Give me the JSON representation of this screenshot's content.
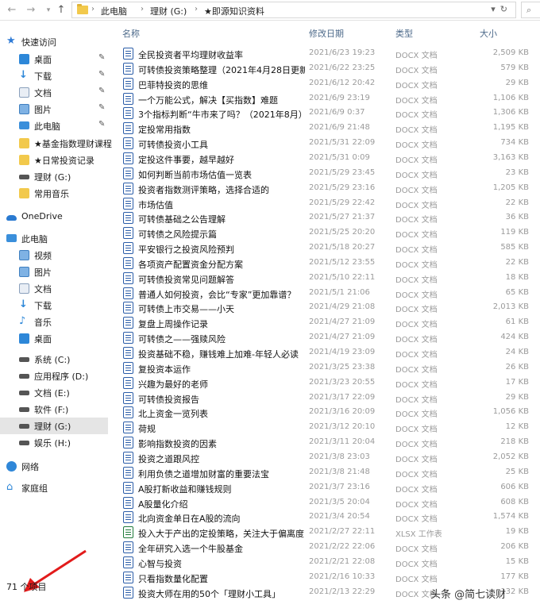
{
  "address_bar": {
    "segments": [
      "此电脑",
      "理财 (G:)",
      "★即源知识资料"
    ]
  },
  "sidebar": {
    "items": [
      {
        "label": "快速访问",
        "icon": "star-icon",
        "selected": false,
        "pinned": false
      },
      {
        "label": "桌面",
        "icon": "desktop-icon",
        "selected": false,
        "pinned": true
      },
      {
        "label": "下载",
        "icon": "download-icon",
        "selected": false,
        "pinned": true
      },
      {
        "label": "文档",
        "icon": "documents-icon",
        "selected": false,
        "pinned": true
      },
      {
        "label": "图片",
        "icon": "pictures-icon",
        "selected": false,
        "pinned": true
      },
      {
        "label": "此电脑",
        "icon": "computer-icon",
        "selected": false,
        "pinned": true
      },
      {
        "label": "★基金指数理财课程",
        "icon": "folder-icon",
        "selected": false,
        "pinned": false
      },
      {
        "label": "★日常投资记录",
        "icon": "folder-icon",
        "selected": false,
        "pinned": false
      },
      {
        "label": "理财 (G:)",
        "icon": "drive-icon",
        "selected": false,
        "pinned": false
      },
      {
        "label": "常用音乐",
        "icon": "folder-icon",
        "selected": false,
        "pinned": false
      },
      {
        "label": "OneDrive",
        "icon": "onedrive-icon",
        "selected": false,
        "pinned": false
      },
      {
        "label": "此电脑",
        "icon": "computer-icon",
        "selected": false,
        "pinned": false
      },
      {
        "label": "视频",
        "icon": "videos-icon",
        "selected": false,
        "pinned": false
      },
      {
        "label": "图片",
        "icon": "pictures-icon",
        "selected": false,
        "pinned": false
      },
      {
        "label": "文档",
        "icon": "documents-icon",
        "selected": false,
        "pinned": false
      },
      {
        "label": "下载",
        "icon": "download-icon",
        "selected": false,
        "pinned": false
      },
      {
        "label": "音乐",
        "icon": "music-icon",
        "selected": false,
        "pinned": false
      },
      {
        "label": "桌面",
        "icon": "desktop-icon",
        "selected": false,
        "pinned": false
      },
      {
        "label": "系统 (C:)",
        "icon": "drive-icon",
        "selected": false,
        "pinned": false
      },
      {
        "label": "应用程序 (D:)",
        "icon": "drive-icon",
        "selected": false,
        "pinned": false
      },
      {
        "label": "文档 (E:)",
        "icon": "drive-icon",
        "selected": false,
        "pinned": false
      },
      {
        "label": "软件 (F:)",
        "icon": "drive-icon",
        "selected": false,
        "pinned": false
      },
      {
        "label": "理财 (G:)",
        "icon": "drive-icon",
        "selected": true,
        "pinned": false
      },
      {
        "label": "娱乐 (H:)",
        "icon": "drive-icon",
        "selected": false,
        "pinned": false
      },
      {
        "label": "网络",
        "icon": "network-icon",
        "selected": false,
        "pinned": false
      },
      {
        "label": "家庭组",
        "icon": "homegroup-icon",
        "selected": false,
        "pinned": false
      }
    ]
  },
  "columns": {
    "name": "名称",
    "date": "修改日期",
    "type": "类型",
    "size": "大小"
  },
  "files": [
    {
      "name": "全民投资者平均理财收益率",
      "date": "2021/6/23 19:23",
      "type": "DOCX 文档",
      "size": "2,509 KB",
      "kind": "docx"
    },
    {
      "name": "可转债投资策略整理（2021年4月28日更新）",
      "date": "2021/6/22 23:25",
      "type": "DOCX 文档",
      "size": "579 KB",
      "kind": "docx"
    },
    {
      "name": "巴菲特投资的思维",
      "date": "2021/6/12 20:42",
      "type": "DOCX 文档",
      "size": "29 KB",
      "kind": "docx"
    },
    {
      "name": "一个万能公式，解决【买指数】难题",
      "date": "2021/6/9 23:19",
      "type": "DOCX 文档",
      "size": "1,106 KB",
      "kind": "docx"
    },
    {
      "name": "3个指标判断“牛市来了吗？（2021年8月）",
      "date": "2021/6/9 0:37",
      "type": "DOCX 文档",
      "size": "1,306 KB",
      "kind": "docx"
    },
    {
      "name": "定投常用指数",
      "date": "2021/6/9 21:48",
      "type": "DOCX 文档",
      "size": "1,195 KB",
      "kind": "docx"
    },
    {
      "name": "可转债投资小工具",
      "date": "2021/5/31 22:09",
      "type": "DOCX 文档",
      "size": "734 KB",
      "kind": "docx"
    },
    {
      "name": "定投这件事要，越早越好",
      "date": "2021/5/31 0:09",
      "type": "DOCX 文档",
      "size": "3,163 KB",
      "kind": "docx"
    },
    {
      "name": "如何判断当前市场估值一览表",
      "date": "2021/5/29 23:45",
      "type": "DOCX 文档",
      "size": "23 KB",
      "kind": "docx"
    },
    {
      "name": "投资者指数测评策略，选择合适的",
      "date": "2021/5/29 23:16",
      "type": "DOCX 文档",
      "size": "1,205 KB",
      "kind": "docx"
    },
    {
      "name": "市场估值",
      "date": "2021/5/29 22:42",
      "type": "DOCX 文档",
      "size": "22 KB",
      "kind": "docx"
    },
    {
      "name": "可转债基础之公告理解",
      "date": "2021/5/27 21:37",
      "type": "DOCX 文档",
      "size": "36 KB",
      "kind": "docx"
    },
    {
      "name": "可转债之风险提示篇",
      "date": "2021/5/25 20:20",
      "type": "DOCX 文档",
      "size": "119 KB",
      "kind": "docx"
    },
    {
      "name": "平安银行之投资风险预判",
      "date": "2021/5/18 20:27",
      "type": "DOCX 文档",
      "size": "585 KB",
      "kind": "docx"
    },
    {
      "name": "各项资产配置资金分配方案",
      "date": "2021/5/12 23:55",
      "type": "DOCX 文档",
      "size": "22 KB",
      "kind": "docx"
    },
    {
      "name": "可转债投资常见问题解答",
      "date": "2021/5/10 22:11",
      "type": "DOCX 文档",
      "size": "18 KB",
      "kind": "docx"
    },
    {
      "name": "普通人如何投资，会比“专家”更加靠谱？",
      "date": "2021/5/1 21:06",
      "type": "DOCX 文档",
      "size": "65 KB",
      "kind": "docx"
    },
    {
      "name": "可转债上市交易——小天",
      "date": "2021/4/29 21:08",
      "type": "DOCX 文档",
      "size": "2,013 KB",
      "kind": "docx"
    },
    {
      "name": "复盘上周操作记录",
      "date": "2021/4/27 21:09",
      "type": "DOCX 文档",
      "size": "61 KB",
      "kind": "docx"
    },
    {
      "name": "可转债之——强赎风险",
      "date": "2021/4/27 21:09",
      "type": "DOCX 文档",
      "size": "424 KB",
      "kind": "docx"
    },
    {
      "name": "投资基础不稳，赚钱难上加难-年轻人必读",
      "date": "2021/4/19 23:09",
      "type": "DOCX 文档",
      "size": "24 KB",
      "kind": "docx"
    },
    {
      "name": "复投资本运作",
      "date": "2021/3/25 23:38",
      "type": "DOCX 文档",
      "size": "26 KB",
      "kind": "docx"
    },
    {
      "name": "兴趣为最好的老师",
      "date": "2021/3/23 20:55",
      "type": "DOCX 文档",
      "size": "17 KB",
      "kind": "docx"
    },
    {
      "name": "可转债投资报告",
      "date": "2021/3/17 22:09",
      "type": "DOCX 文档",
      "size": "29 KB",
      "kind": "docx"
    },
    {
      "name": "北上资金一览列表",
      "date": "2021/3/16 20:09",
      "type": "DOCX 文档",
      "size": "1,056 KB",
      "kind": "docx"
    },
    {
      "name": "荷规",
      "date": "2021/3/12 20:10",
      "type": "DOCX 文档",
      "size": "12 KB",
      "kind": "docx"
    },
    {
      "name": "影响指数投资的因素",
      "date": "2021/3/11 20:04",
      "type": "DOCX 文档",
      "size": "218 KB",
      "kind": "docx"
    },
    {
      "name": "投资之道跟风控",
      "date": "2021/3/8 23:03",
      "type": "DOCX 文档",
      "size": "2,052 KB",
      "kind": "docx"
    },
    {
      "name": "利用负债之道增加财富的重要法宝",
      "date": "2021/3/8 21:48",
      "type": "DOCX 文档",
      "size": "25 KB",
      "kind": "docx"
    },
    {
      "name": "A股打新收益和赚钱规则",
      "date": "2021/3/7 23:16",
      "type": "DOCX 文档",
      "size": "606 KB",
      "kind": "docx"
    },
    {
      "name": "A股量化介绍",
      "date": "2021/3/5 20:04",
      "type": "DOCX 文档",
      "size": "608 KB",
      "kind": "docx"
    },
    {
      "name": "北向资金单日在A股的流向",
      "date": "2021/3/4 20:54",
      "type": "DOCX 文档",
      "size": "1,574 KB",
      "kind": "docx"
    },
    {
      "name": "投入大于产出的定投策略，关注大于偏离度",
      "date": "2021/2/27 22:11",
      "type": "XLSX 工作表",
      "size": "19 KB",
      "kind": "xlsx"
    },
    {
      "name": "全年研究入选一个牛股基金",
      "date": "2021/2/22 22:06",
      "type": "DOCX 文档",
      "size": "206 KB",
      "kind": "docx"
    },
    {
      "name": "心智与投资",
      "date": "2021/2/21 22:08",
      "type": "DOCX 文档",
      "size": "15 KB",
      "kind": "docx"
    },
    {
      "name": "只看指数量化配置",
      "date": "2021/2/16 10:33",
      "type": "DOCX 文档",
      "size": "177 KB",
      "kind": "docx"
    },
    {
      "name": "投资大师在用的50个「理财小工具」",
      "date": "2021/2/13 22:29",
      "type": "DOCX 文档",
      "size": "132 KB",
      "kind": "docx"
    }
  ],
  "status_bar": {
    "item_count": "71 个项目"
  },
  "watermark": {
    "text": "头条 @简七读财"
  }
}
